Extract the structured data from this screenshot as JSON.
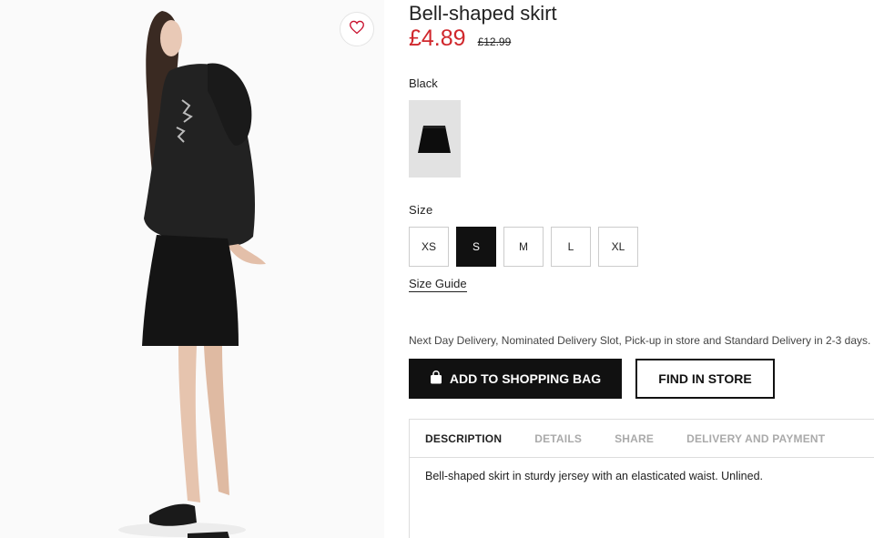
{
  "product": {
    "title": "Bell-shaped skirt",
    "price_current": "£4.89",
    "price_original": "£12.99",
    "color_label": "Black",
    "size_label": "Size",
    "sizes": [
      "XS",
      "S",
      "M",
      "L",
      "XL"
    ],
    "selected_size": "S",
    "size_guide": "Size Guide",
    "delivery_info": "Next Day Delivery, Nominated Delivery Slot, Pick-up in store and Standard Delivery in 2-3 days.",
    "add_to_bag": "ADD TO SHOPPING BAG",
    "find_in_store": "FIND IN STORE"
  },
  "tabs": [
    {
      "label": "DESCRIPTION"
    },
    {
      "label": "DETAILS"
    },
    {
      "label": "SHARE"
    },
    {
      "label": "DELIVERY AND PAYMENT"
    }
  ],
  "active_tab": "DESCRIPTION",
  "description_text": "Bell-shaped skirt in sturdy jersey with an elasticated waist. Unlined.",
  "colors": {
    "price_sale": "#d0272c",
    "primary_button": "#111111",
    "swatch_bg": "#e2e2e2"
  },
  "icons": {
    "wishlist": "heart-icon",
    "bag": "shopping-bag-icon"
  }
}
